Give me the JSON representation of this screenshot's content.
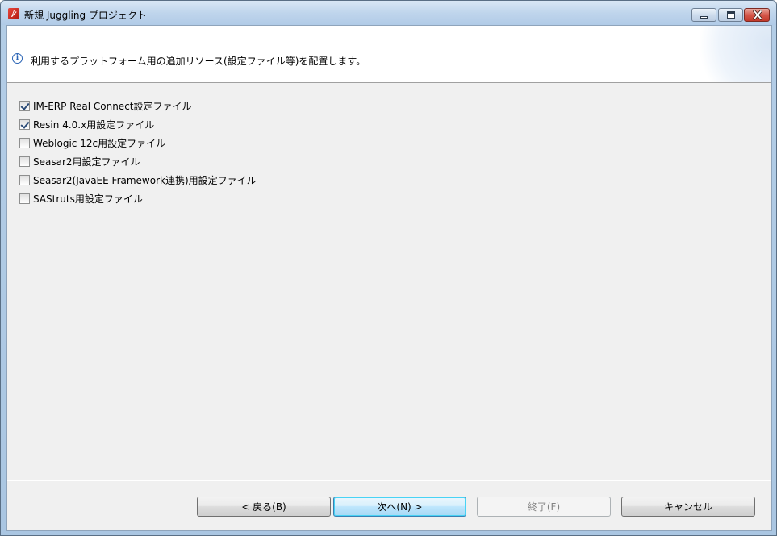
{
  "window": {
    "title": "新規 Juggling プロジェクト"
  },
  "banner": {
    "message": "利用するプラットフォーム用の追加リソース(設定ファイル等)を配置します。"
  },
  "resources": [
    {
      "label": "IM-ERP Real Connect設定ファイル",
      "checked": true
    },
    {
      "label": "Resin 4.0.x用設定ファイル",
      "checked": true
    },
    {
      "label": "Weblogic 12c用設定ファイル",
      "checked": false
    },
    {
      "label": "Seasar2用設定ファイル",
      "checked": false
    },
    {
      "label": "Seasar2(JavaEE Framework連携)用設定ファイル",
      "checked": false
    },
    {
      "label": "SAStruts用設定ファイル",
      "checked": false
    }
  ],
  "buttons": {
    "back": "< 戻る(B)",
    "next": "次へ(N) >",
    "finish": "終了(F)",
    "cancel": "キャンセル"
  }
}
